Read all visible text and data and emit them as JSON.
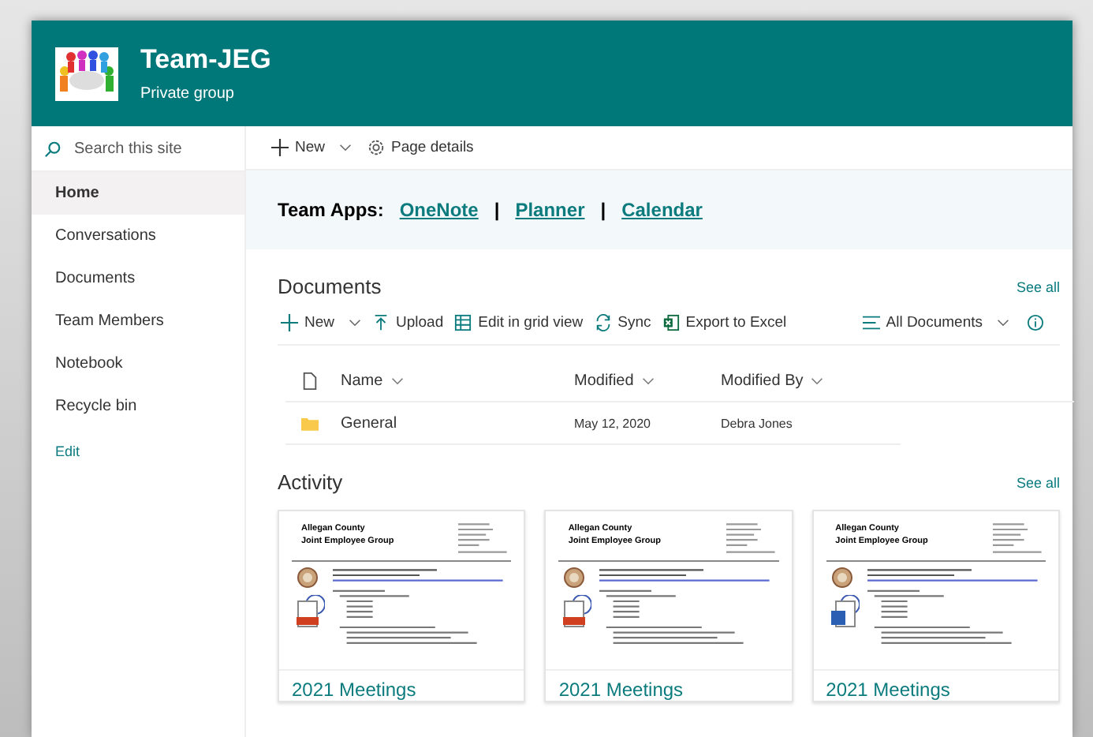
{
  "site": {
    "title": "Team-JEG",
    "subtitle": "Private group"
  },
  "search": {
    "placeholder": "Search this site"
  },
  "nav": [
    {
      "label": "Home",
      "selected": true
    },
    {
      "label": "Conversations",
      "selected": false
    },
    {
      "label": "Documents",
      "selected": false
    },
    {
      "label": "Team Members",
      "selected": false
    },
    {
      "label": "Notebook",
      "selected": false
    },
    {
      "label": "Recycle bin",
      "selected": false
    }
  ],
  "nav_edit": "Edit",
  "commands": [
    {
      "kind": "new",
      "label": "New"
    },
    {
      "kind": "details",
      "label": "Page details"
    }
  ],
  "team_apps": {
    "label": "Team Apps:",
    "links": [
      "OneNote",
      "Planner",
      "Calendar"
    ],
    "separator": "|"
  },
  "documents": {
    "title": "Documents",
    "see_all": "See all",
    "toolbar": [
      {
        "kind": "new",
        "label": "New"
      },
      {
        "kind": "upload",
        "label": "Upload"
      },
      {
        "kind": "grid",
        "label": "Edit in grid view"
      },
      {
        "kind": "sync",
        "label": "Sync"
      },
      {
        "kind": "excel",
        "label": "Export to Excel"
      }
    ],
    "view": "All Documents",
    "columns": [
      "Name",
      "Modified",
      "Modified By"
    ],
    "rows": [
      {
        "name": "General",
        "modified": "May 12, 2020",
        "modified_by": "Debra Jones"
      }
    ]
  },
  "activity": {
    "title": "Activity",
    "see_all": "See all",
    "cards": [
      {
        "doc_title": [
          "Allegan County",
          "Joint Employee Group"
        ],
        "kind": "pdf",
        "title": "2021 Meetings"
      },
      {
        "doc_title": [
          "Allegan County",
          "Joint Employee Group"
        ],
        "kind": "pdf",
        "title": "2021 Meetings"
      },
      {
        "doc_title": [
          "Allegan County",
          "Joint Employee Group"
        ],
        "kind": "word",
        "title": "2021 Meetings"
      }
    ]
  }
}
